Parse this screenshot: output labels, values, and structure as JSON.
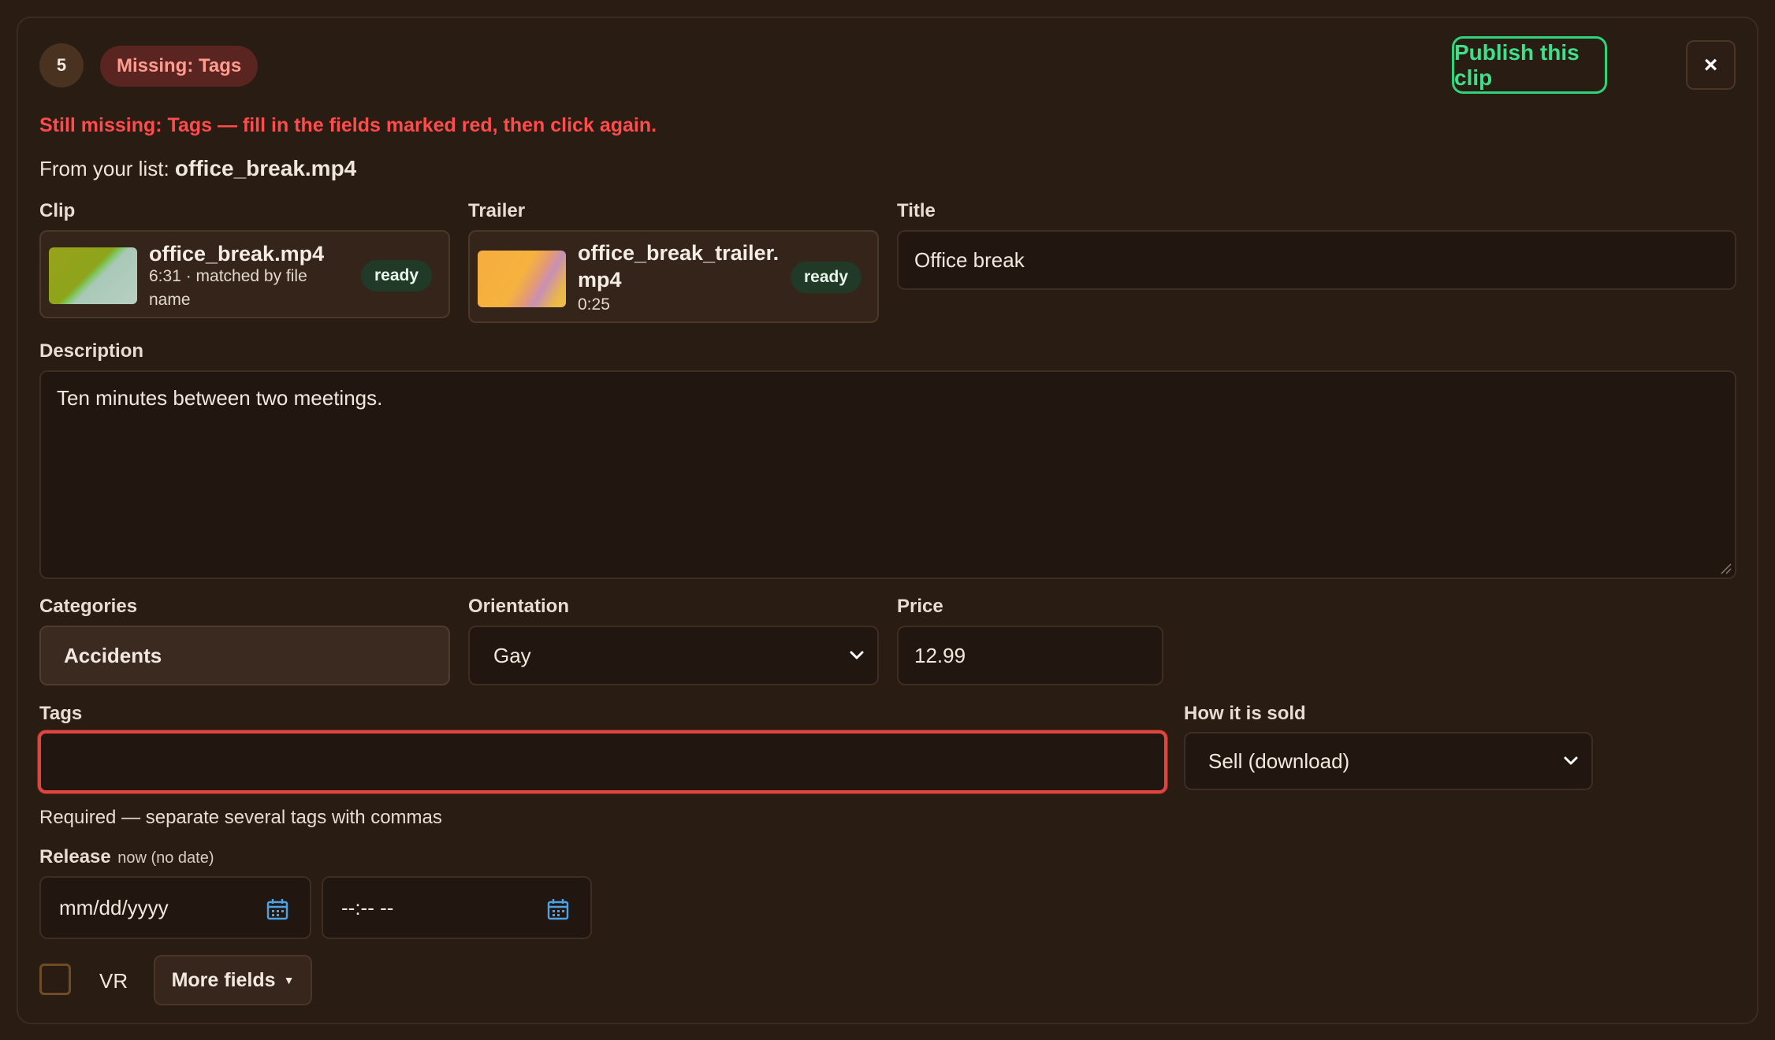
{
  "header": {
    "step_number": "5",
    "missing_badge": "Missing: Tags",
    "publish_label": "Publish this clip",
    "close_label": "×"
  },
  "error_message": "Still missing: Tags — fill in the fields marked red, then click again.",
  "source": {
    "prefix": "From your list:",
    "filename": "office_break.mp4"
  },
  "clip": {
    "label": "Clip",
    "filename": "office_break.mp4",
    "details": "6:31 · matched by file name",
    "status": "ready"
  },
  "trailer": {
    "label": "Trailer",
    "filename": "office_break_trailer.mp4",
    "duration": "0:25",
    "status": "ready"
  },
  "title_field": {
    "label": "Title",
    "value": "Office break"
  },
  "description_field": {
    "label": "Description",
    "value": "Ten minutes between two meetings."
  },
  "categories_field": {
    "label": "Categories",
    "value": "Accidents"
  },
  "orientation_field": {
    "label": "Orientation",
    "value": "Gay"
  },
  "price_field": {
    "label": "Price",
    "value": "12.99"
  },
  "tags_field": {
    "label": "Tags",
    "value": "",
    "helper": "Required — separate several tags with commas"
  },
  "sold_field": {
    "label": "How it is sold",
    "value": "Sell (download)"
  },
  "release": {
    "label": "Release",
    "note": "now (no date)",
    "date_placeholder": "mm/dd/yyyy",
    "time_placeholder": "--:-- --"
  },
  "vr_label": "VR",
  "more_fields_label": "More fields",
  "colors": {
    "background": "#291c12",
    "error_red": "#ff4b4b",
    "publish_green": "#3ee08a",
    "calendar_icon": "#4aa3e8"
  },
  "icons": [
    "close-icon",
    "chevron-down-icon",
    "calendar-icon",
    "caret-down-icon"
  ]
}
